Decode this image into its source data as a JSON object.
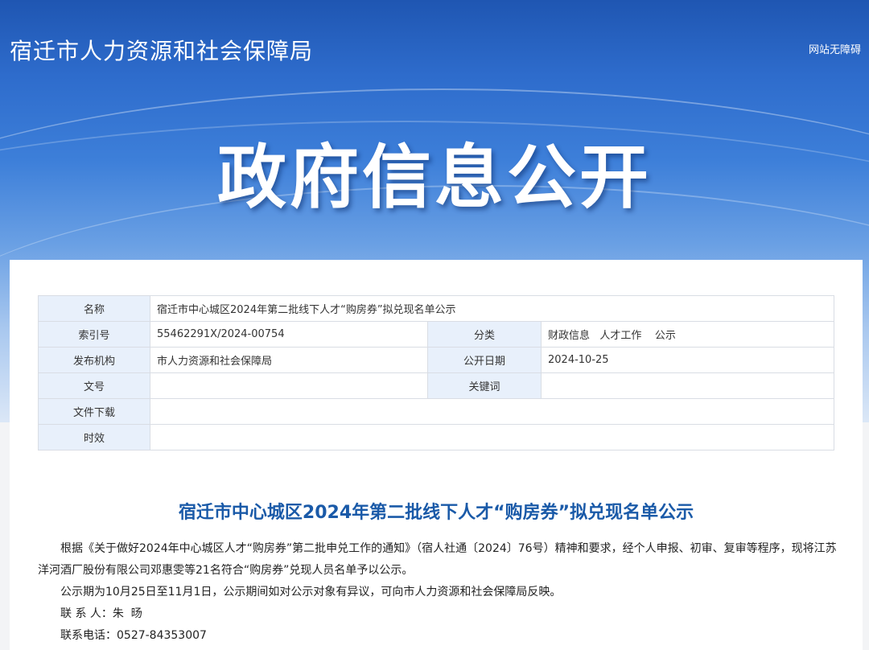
{
  "header": {
    "site_title": "宿迁市人力资源和社会保障局",
    "accessibility_link": "网站无障碍",
    "hero_title": "政府信息公开"
  },
  "info_table": {
    "name_label": "名称",
    "name_value": "宿迁市中心城区2024年第二批线下人才“购房券”拟兑现名单公示",
    "index_label": "索引号",
    "index_value": "55462291X/2024-00754",
    "category_label": "分类",
    "category_value": "财政信息   人才工作    公示",
    "publisher_label": "发布机构",
    "publisher_value": "市人力资源和社会保障局",
    "date_label": "公开日期",
    "date_value": "2024-10-25",
    "doc_no_label": "文号",
    "doc_no_value": "",
    "keywords_label": "关键词",
    "keywords_value": "",
    "download_label": "文件下载",
    "download_value": "",
    "validity_label": "时效",
    "validity_value": ""
  },
  "article": {
    "title": "宿迁市中心城区2024年第二批线下人才“购房券”拟兑现名单公示",
    "paragraphs": [
      "根据《关于做好2024年中心城区人才“购房券”第二批申兑工作的通知》（宿人社通〔2024〕76号）精神和要求，经个人申报、初审、复审等程序，现将江苏洋河酒厂股份有限公司邓惠雯等21名符合“购房券”兑现人员名单予以公示。",
      "公示期为10月25日至11月1日，公示期间如对公示对象有异议，可向市人力资源和社会保障局反映。",
      "联 系 人：朱  旸",
      "联系电话：0527-84353007"
    ]
  }
}
